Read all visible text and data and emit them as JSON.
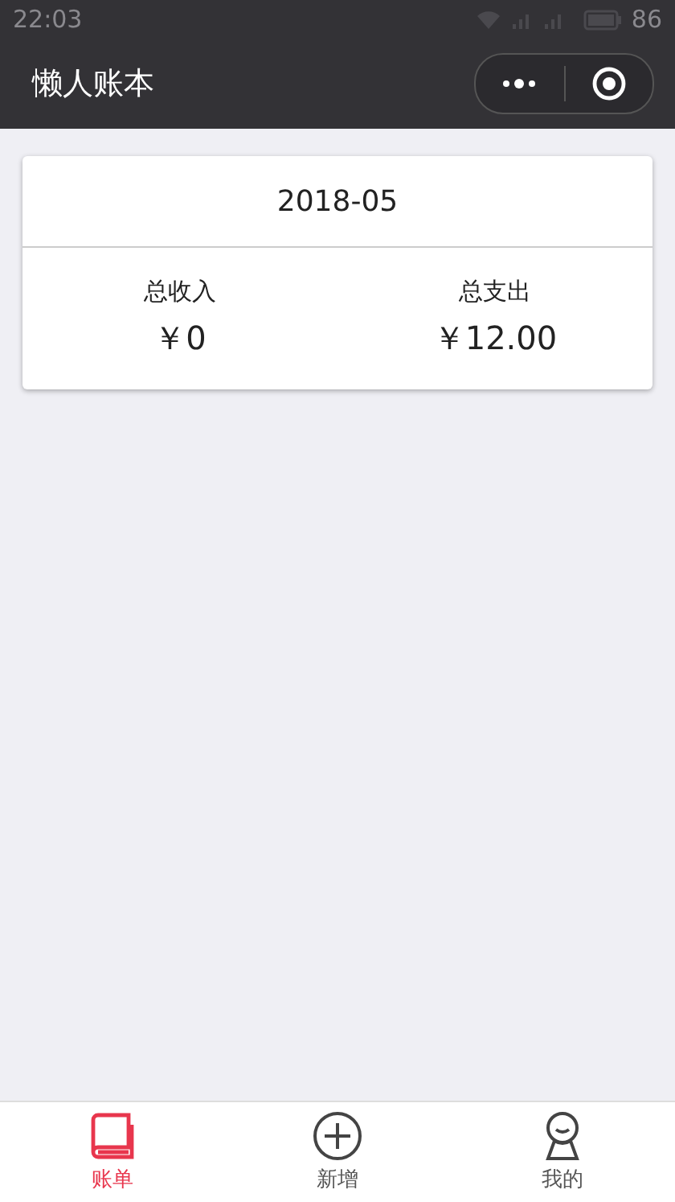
{
  "status_bar": {
    "time": "22:03",
    "battery": "86"
  },
  "nav_bar": {
    "title": "懒人账本"
  },
  "summary": {
    "month": "2018-05",
    "totals": [
      {
        "label": "总收入",
        "amount": "￥0"
      },
      {
        "label": "总支出",
        "amount": "￥12.00"
      }
    ]
  },
  "tab_bar": [
    {
      "label": "账单",
      "kind": "book",
      "selected": true
    },
    {
      "label": "新增",
      "kind": "add",
      "selected": false
    },
    {
      "label": "我的",
      "kind": "figure",
      "selected": false
    }
  ]
}
